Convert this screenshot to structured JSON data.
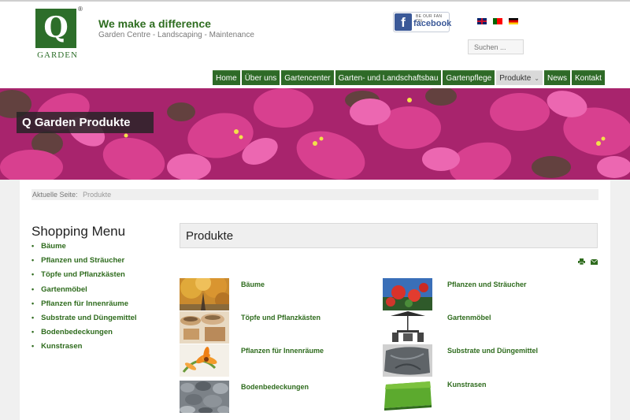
{
  "brand": {
    "logo_letter": "Q",
    "logo_word": "GARDEN",
    "registered": "®",
    "tagline": "We make a difference",
    "subline": "Garden Centre - Landscaping - Maintenance"
  },
  "social": {
    "small": "BE OUR FAN ON",
    "big": "facebook",
    "icon": "facebook-f-icon"
  },
  "languages": [
    "english-flag-icon",
    "portuguese-flag-icon",
    "german-flag-icon"
  ],
  "search": {
    "placeholder": "Suchen ..."
  },
  "nav": {
    "items": [
      "Home",
      "Über uns",
      "Gartencenter",
      "Garten- und Landschaftsbau",
      "Gartenpflege",
      "Produkte",
      "News",
      "Kontakt"
    ],
    "active": "Produkte"
  },
  "banner": {
    "title": "Q Garden Produkte"
  },
  "breadcrumb": {
    "label": "Aktuelle Seite:",
    "current": "Produkte"
  },
  "sidebar": {
    "title": "Shopping Menu",
    "items": [
      "Bäume",
      "Pflanzen und Sträucher",
      "Töpfe und Pflanzkästen",
      "Gartenmöbel",
      "Pflanzen für Innenräume",
      "Substrate und Düngemittel",
      "Bodenbedeckungen",
      "Kunstrasen"
    ]
  },
  "main": {
    "heading": "Produkte",
    "tools": [
      "print-icon",
      "mail-icon"
    ],
    "products": [
      {
        "label": "Bäume",
        "thumb": "tree-photo"
      },
      {
        "label": "Pflanzen und Sträucher",
        "thumb": "red-flower-shrub-photo"
      },
      {
        "label": "Töpfe und Pflanzkästen",
        "thumb": "clay-pots-photo"
      },
      {
        "label": "Gartenmöbel",
        "thumb": "patio-furniture-photo"
      },
      {
        "label": "Pflanzen für Innenräume",
        "thumb": "orange-flower-photo"
      },
      {
        "label": "Substrate und Düngemittel",
        "thumb": "soil-bag-photo"
      },
      {
        "label": "Bodenbedeckungen",
        "thumb": "pebbles-photo"
      },
      {
        "label": "Kunstrasen",
        "thumb": "artificial-grass-photo"
      }
    ]
  },
  "colors": {
    "brand_green": "#2e6a27",
    "link_green": "#2e6b1d",
    "banner_pink": "#d23c8f"
  }
}
